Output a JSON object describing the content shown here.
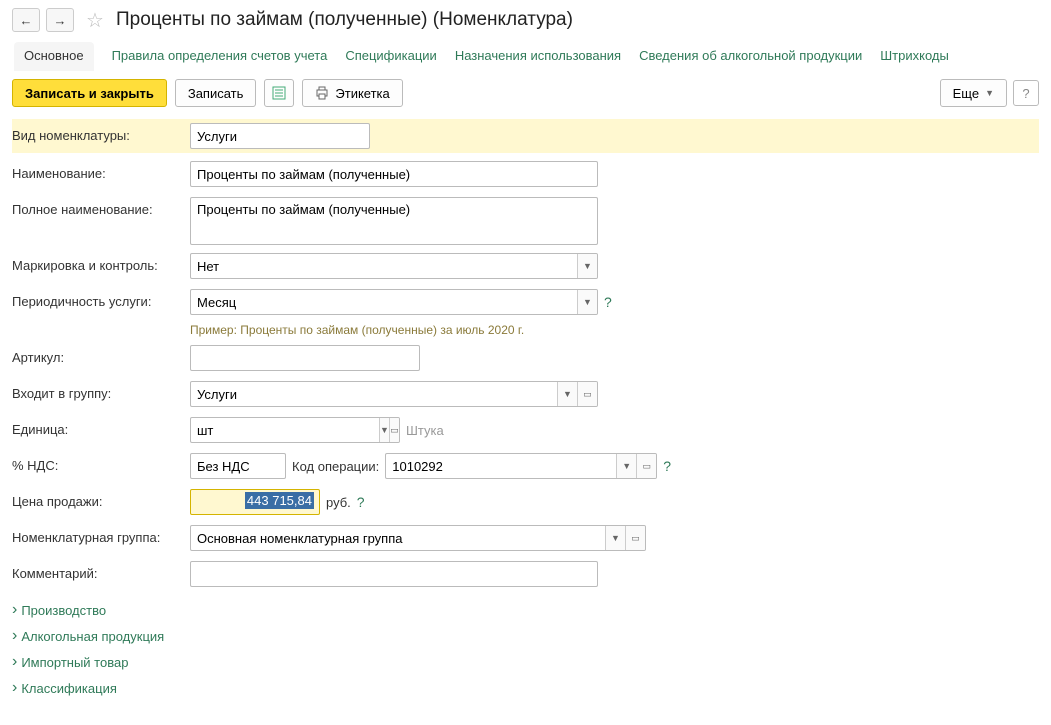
{
  "header": {
    "title": "Проценты по займам (полученные) (Номенклатура)"
  },
  "tabs": [
    {
      "label": "Основное",
      "active": true
    },
    {
      "label": "Правила определения счетов учета"
    },
    {
      "label": "Спецификации"
    },
    {
      "label": "Назначения использования"
    },
    {
      "label": "Сведения об алкогольной продукции"
    },
    {
      "label": "Штрихкоды"
    }
  ],
  "toolbar": {
    "saveClose": "Записать и закрыть",
    "save": "Записать",
    "label": "Этикетка",
    "more": "Еще"
  },
  "fields": {
    "typeLabel": "Вид номенклатуры:",
    "typeValue": "Услуги",
    "nameLabel": "Наименование:",
    "nameValue": "Проценты по займам (полученные)",
    "fullNameLabel": "Полное наименование:",
    "fullNameValue": "Проценты по займам (полученные)",
    "markingLabel": "Маркировка и контроль:",
    "markingValue": "Нет",
    "periodLabel": "Периодичность услуги:",
    "periodValue": "Месяц",
    "periodHint": "Пример: Проценты по займам (полученные) за июль 2020 г.",
    "artLabel": "Артикул:",
    "artValue": "",
    "groupLabel": "Входит в группу:",
    "groupValue": "Услуги",
    "unitLabel": "Единица:",
    "unitValue": "шт",
    "unitDesc": "Штука",
    "vatLabel": "% НДС:",
    "vatValue": "Без НДС",
    "opLabel": "Код операции:",
    "opValue": "1010292",
    "priceLabel": "Цена продажи:",
    "priceValue": "443 715,84",
    "priceUnit": "руб.",
    "nomGroupLabel": "Номенклатурная группа:",
    "nomGroupValue": "Основная номенклатурная группа",
    "commentLabel": "Комментарий:",
    "commentValue": ""
  },
  "expandables": [
    "Производство",
    "Алкогольная продукция",
    "Импортный товар",
    "Классификация"
  ]
}
